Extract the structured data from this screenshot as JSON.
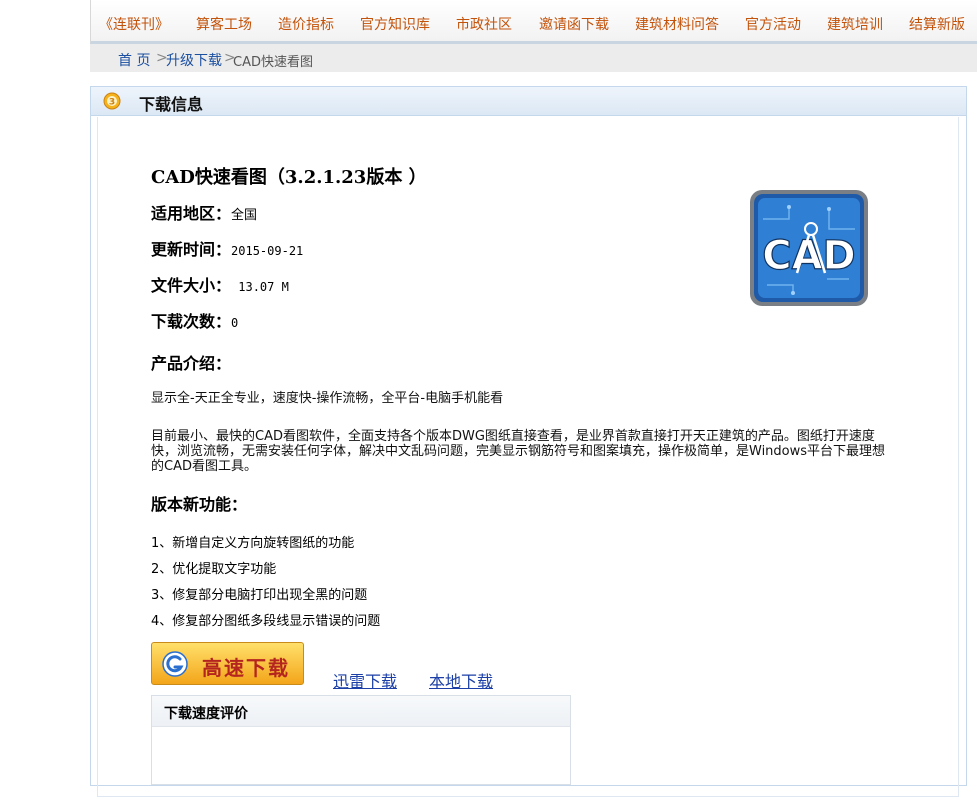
{
  "nav": {
    "items": [
      "《连联刊》",
      "算客工场",
      "造价指标",
      "官方知识库",
      "市政社区",
      "邀请函下载",
      "建筑材料问答",
      "官方活动",
      "建筑培训",
      "结算新版"
    ]
  },
  "breadcrumb": {
    "home": "首 页",
    "sep1": ">",
    "section": "升级下载",
    "sep2": ">",
    "current": "CAD快速看图"
  },
  "panel": {
    "title": "下载信息"
  },
  "product": {
    "title": "CAD快速看图（3.2.1.23版本 ）",
    "region_label": "适用地区：",
    "region_value": "全国",
    "updated_label": "更新时间：",
    "updated_value": "2015-09-21",
    "size_label": "文件大小：",
    "size_value": " 13.07 M",
    "downloads_label": "下载次数：",
    "downloads_value": "0",
    "logo_text": "CAD"
  },
  "intro": {
    "heading": "产品介绍：",
    "tagline": "显示全-天正全专业，速度快-操作流畅，全平台-电脑手机能看",
    "description": "目前最小、最快的CAD看图软件，全面支持各个版本DWG图纸直接查看，是业界首款直接打开天正建筑的产品。图纸打开速度快，浏览流畅，无需安装任何字体，解决中文乱码问题，完美显示钢筋符号和图案填充，操作极简单，是Windows平台下最理想的CAD看图工具。"
  },
  "features": {
    "heading": "版本新功能：",
    "items": [
      "1、新增自定义方向旋转图纸的功能",
      "2、优化提取文字功能",
      "3、修复部分电脑打印出现全黑的问题",
      "4、修复部分图纸多段线显示错误的问题"
    ]
  },
  "download": {
    "fast_label": "高速下载",
    "xunlei_label": "迅雷下载",
    "local_label": "本地下载"
  },
  "rating": {
    "title": "下载速度评价"
  },
  "colors": {
    "nav_text": "#c3530a",
    "link": "#1b3fa6",
    "button_text": "#b5251f"
  }
}
